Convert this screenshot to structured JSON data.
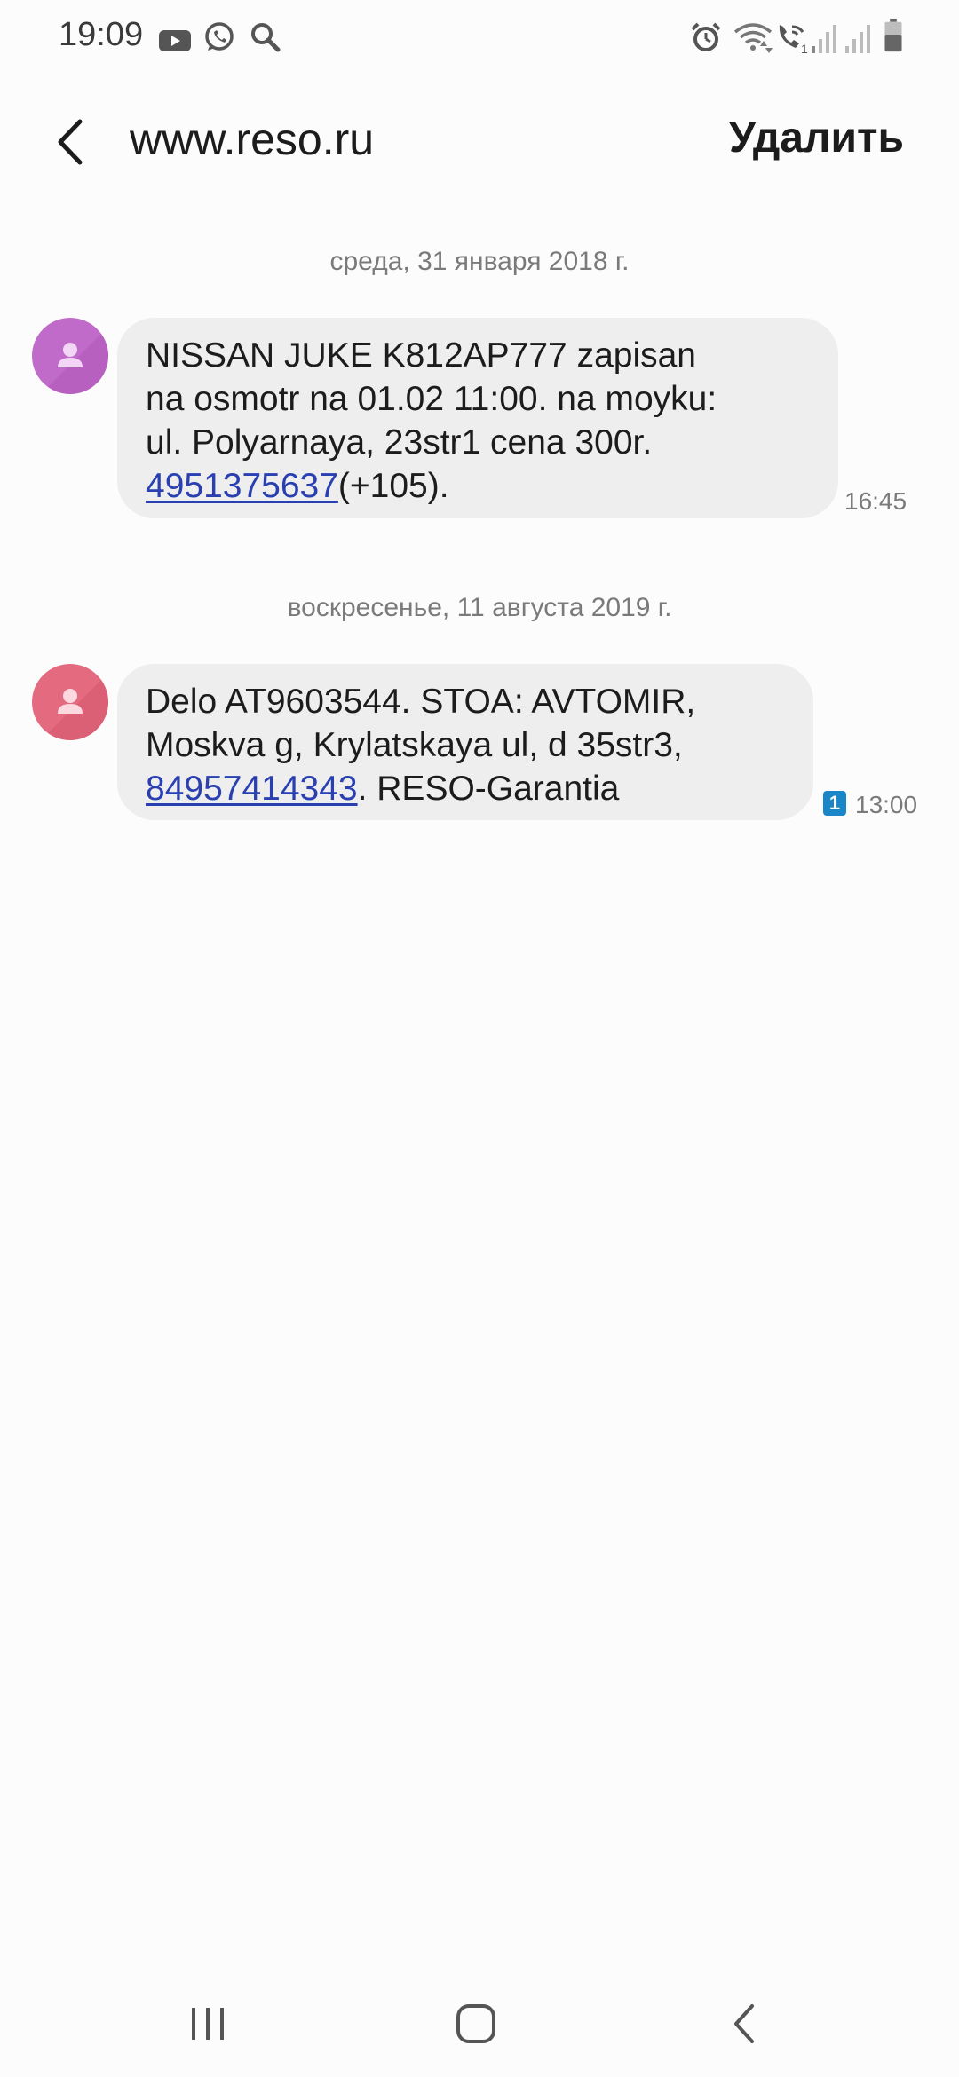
{
  "status_bar": {
    "time": "19:09",
    "left_icons": [
      "youtube-icon",
      "whatsapp-icon",
      "search-icon"
    ],
    "right_icons": [
      "alarm-icon",
      "wifi-icon",
      "wifi-calling-icon",
      "signal-sim1-icon",
      "signal-sim2-icon",
      "battery-icon"
    ]
  },
  "app_bar": {
    "title": "www.reso.ru",
    "delete_label": "Удалить"
  },
  "conversation": {
    "groups": [
      {
        "date": "среда, 31 января 2018 г.",
        "avatar_color": "#c06ac9",
        "message": {
          "line1": "NISSAN JUKE K812AP777 zapisan",
          "line2": "na osmotr na 01.02 11:00. na moyku:",
          "line3": "ul. Polyarnaya, 23str1 cena 300r.",
          "phone": "4951375637",
          "line4_rest": "(+105).",
          "time": "16:45"
        }
      },
      {
        "date": "воскресенье, 11 августа 2019 г.",
        "avatar_color": "#e46a80",
        "message": {
          "line1": "Delo AT9603544. STOA: AVTOMIR,",
          "line2": "Moskva g, Krylatskaya ul, d 35str3,",
          "phone": "84957414343",
          "line3_rest": ". RESO-Garantia",
          "sim": "1",
          "time": "13:00"
        }
      }
    ]
  },
  "colors": {
    "bubble": "#eeeeee",
    "link": "#2a3fb0",
    "sim_badge": "#1a86c8"
  }
}
